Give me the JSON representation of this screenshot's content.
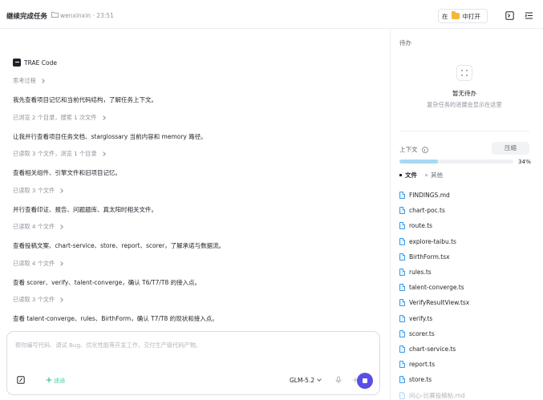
{
  "header": {
    "title": "继续完成任务",
    "workspace": "wenxinxin",
    "separator": "·",
    "time": "23:51",
    "open_in_prefix": "在",
    "open_in_label": "中打开"
  },
  "chat": {
    "brand": "TRAE Code",
    "entries": [
      {
        "kind": "meta",
        "text": "思考过程"
      },
      {
        "kind": "msg",
        "text": "我先查看项目记忆和当前代码结构，了解任务上下文。"
      },
      {
        "kind": "meta",
        "text": "已浏览 2 个目录，搜索 1 次文件"
      },
      {
        "kind": "msg",
        "text": "让我并行查看项目任务文档、starglossary 当前内容和 memory 路径。"
      },
      {
        "kind": "meta",
        "text": "已读取 3 个文件，浏览 1 个目录"
      },
      {
        "kind": "msg",
        "text": "查看相关组件、引擎文件和旧项目记忆。"
      },
      {
        "kind": "meta",
        "text": "已读取 3 个文件"
      },
      {
        "kind": "msg",
        "text": "并行查看印证、报告、问题题库、真太阳时相关文件。"
      },
      {
        "kind": "meta",
        "text": "已读取 4 个文件"
      },
      {
        "kind": "msg",
        "text": "查看投稿文案、chart-service、store、report、scorer，了解承诺与数据流。"
      },
      {
        "kind": "meta",
        "text": "已读取 4 个文件"
      },
      {
        "kind": "msg",
        "text": "查看 scorer、verify、talent-converge，确认 T6/T7/T8 的接入点。"
      },
      {
        "kind": "meta",
        "text": "已读取 3 个文件"
      },
      {
        "kind": "msg",
        "text": "查看 talent-converge、rules、BirthForm，确认 T7/T8 的现状和接入点。"
      }
    ]
  },
  "composer": {
    "placeholder": "帮你编写代码、调试 Bug、优化性能等开发工作，交付生产级代码产物。",
    "quick_label": "速通",
    "model": "GLM-5.2"
  },
  "sidebar": {
    "todo_title": "待办",
    "todo_empty": "暂无待办",
    "todo_empty_sub": "复杂任务的进展会显示在这里",
    "context_title": "上下文",
    "compress_label": "压缩",
    "context_usage_percent": 34,
    "context_usage_label": "34%",
    "tabs": [
      {
        "label": "文件",
        "active": true
      },
      {
        "label": "其他",
        "active": false
      }
    ],
    "files": [
      "FINDINGS.md",
      "chart-poc.ts",
      "route.ts",
      "explore-taibu.ts",
      "BirthForm.tsx",
      "rules.ts",
      "talent-converge.ts",
      "VerifyResultView.tsx",
      "verify.ts",
      "scorer.ts",
      "chart-service.ts",
      "report.ts",
      "store.ts",
      "问心-比赛投稿帖.md"
    ]
  },
  "colors": {
    "accent": "#5b4ee5",
    "progress": "#a8d8f4",
    "file_icon": "#3b9be8",
    "quick": "#5fd1b1"
  }
}
